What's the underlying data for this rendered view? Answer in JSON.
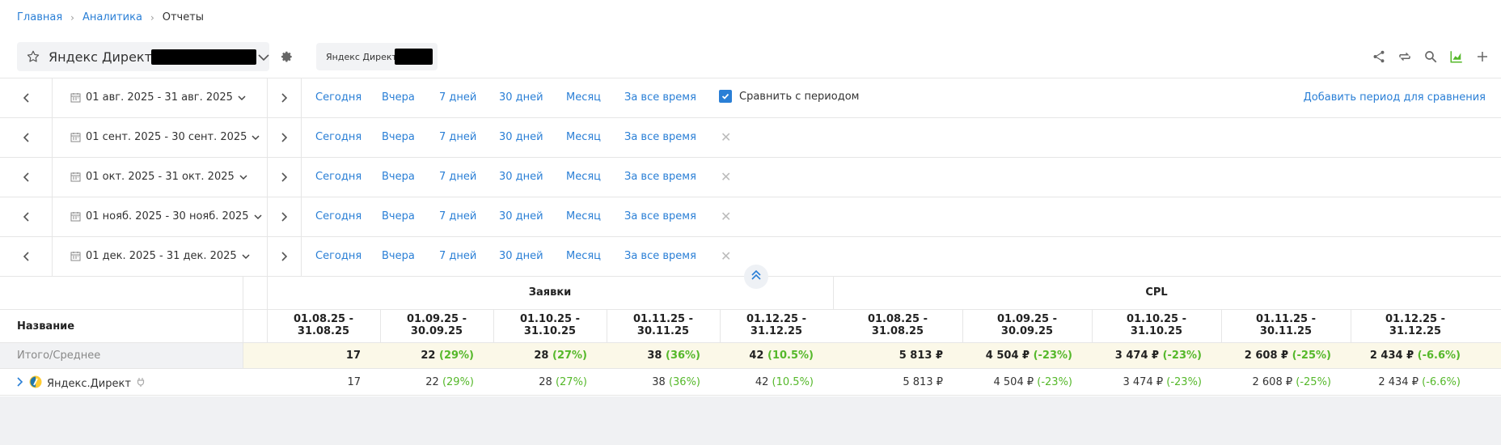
{
  "breadcrumb": [
    "Главная",
    "Аналитика",
    "Отчеты"
  ],
  "selector": {
    "label": "Яндекс Директ -"
  },
  "chip": {
    "label": "Яндекс Директ -"
  },
  "quick": [
    "Сегодня",
    "Вчера",
    "7 дней",
    "30 дней",
    "Месяц",
    "За все время"
  ],
  "compare_label": "Сравнить с периодом",
  "compare_checked": true,
  "add_period": "Добавить период для сравнения",
  "periods": [
    "01 авг. 2025 - 31 авг. 2025",
    "01 сент. 2025 - 30 сент. 2025",
    "01 окт. 2025 - 31 окт. 2025",
    "01 нояб. 2025 - 30 нояб. 2025",
    "01 дек. 2025 - 31 дек. 2025"
  ],
  "table": {
    "name_header": "Название",
    "groups": [
      "Заявки",
      "CPL"
    ],
    "col_dates": [
      [
        "01.08.25 -",
        "31.08.25"
      ],
      [
        "01.09.25 -",
        "30.09.25"
      ],
      [
        "01.10.25 -",
        "31.10.25"
      ],
      [
        "01.11.25 -",
        "30.11.25"
      ],
      [
        "01.12.25 -",
        "31.12.25"
      ],
      [
        "01.08.25 -",
        "31.08.25"
      ],
      [
        "01.09.25 -",
        "30.09.25"
      ],
      [
        "01.10.25 -",
        "31.10.25"
      ],
      [
        "01.11.25 -",
        "30.11.25"
      ],
      [
        "01.12.25 -",
        "31.12.25"
      ]
    ],
    "total_label": "Итого/Среднее",
    "total": [
      {
        "v": "17",
        "d": ""
      },
      {
        "v": "22",
        "d": "(29%)"
      },
      {
        "v": "28",
        "d": "(27%)"
      },
      {
        "v": "38",
        "d": "(36%)"
      },
      {
        "v": "42",
        "d": "(10.5%)"
      },
      {
        "v": "5 813 ₽",
        "d": ""
      },
      {
        "v": "4 504 ₽",
        "d": "(-23%)"
      },
      {
        "v": "3 474 ₽",
        "d": "(-23%)"
      },
      {
        "v": "2 608 ₽",
        "d": "(-25%)"
      },
      {
        "v": "2 434 ₽",
        "d": "(-6.6%)"
      }
    ],
    "row_name": "Яндекс.Директ",
    "row": [
      {
        "v": "17",
        "d": ""
      },
      {
        "v": "22",
        "d": "(29%)"
      },
      {
        "v": "28",
        "d": "(27%)"
      },
      {
        "v": "38",
        "d": "(36%)"
      },
      {
        "v": "42",
        "d": "(10.5%)"
      },
      {
        "v": "5 813 ₽",
        "d": ""
      },
      {
        "v": "4 504 ₽",
        "d": "(-23%)"
      },
      {
        "v": "3 474 ₽",
        "d": "(-23%)"
      },
      {
        "v": "2 608 ₽",
        "d": "(-25%)"
      },
      {
        "v": "2 434 ₽",
        "d": "(-6.6%)"
      }
    ]
  },
  "colors": {
    "link": "#2a7fd6",
    "positive": "#55b82a",
    "total_band": "#fbf8e8"
  }
}
